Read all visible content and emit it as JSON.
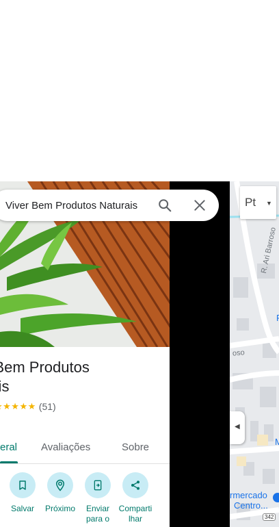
{
  "search": {
    "value": "Viver Bem Produtos Naturais"
  },
  "place": {
    "title_line1": "r Bem Produtos",
    "title_line2": "rais",
    "stars": "★★★★★",
    "review_count": "(51)"
  },
  "tabs": [
    {
      "label": "eral",
      "active": true
    },
    {
      "label": "Avaliações",
      "active": false
    },
    {
      "label": "Sobre",
      "active": false
    }
  ],
  "actions": [
    {
      "label": "Salvar",
      "icon": "bookmark-icon"
    },
    {
      "label": "Próximo",
      "icon": "nearby-icon"
    },
    {
      "label": "Enviar para o",
      "icon": "send-to-phone-icon"
    },
    {
      "label": "Compartilhar",
      "icon": "share-icon"
    }
  ],
  "action_labels": {
    "save": "Salvar",
    "nearby": "Próximo",
    "send_line1": "Enviar",
    "send_line2": "para o",
    "share_line1": "Comparti",
    "share_line2": "lhar"
  },
  "map": {
    "layer_label": "Pt",
    "street_1": "R. Ari Barroso",
    "street_2": "R. Ari Barroso",
    "street_3": "oso",
    "poi_1": "rmercado",
    "poi_2": "Centro...",
    "poi_3": "P",
    "poi_4": "M",
    "route": "342"
  },
  "colors": {
    "accent": "#00796b",
    "action_bg": "#c8ecf5",
    "star": "#f4b400",
    "poi": "#1a73e8"
  }
}
